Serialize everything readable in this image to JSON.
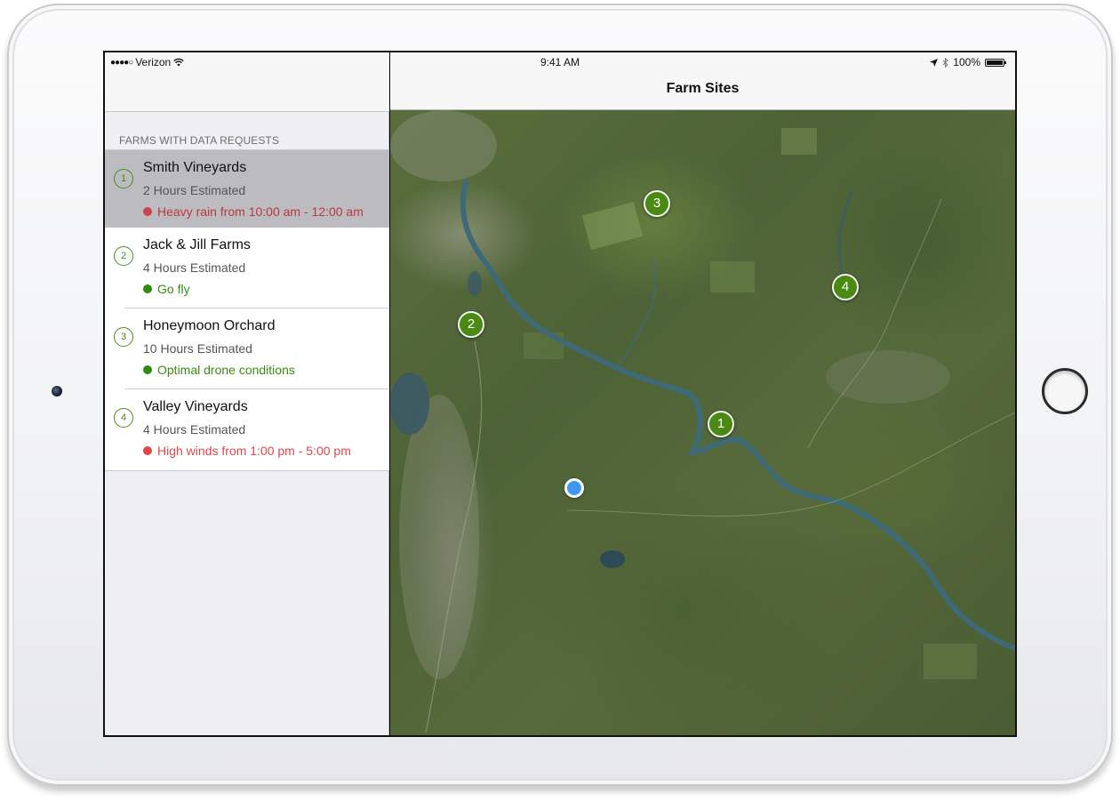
{
  "status_bar": {
    "carrier": "Verizon",
    "signal_dots": "●●●●○",
    "time": "9:41 AM",
    "battery": "100%"
  },
  "master": {
    "section_header": "FARMS WITH DATA REQUESTS",
    "farms": [
      {
        "number": "1",
        "name": "Smith Vineyards",
        "estimate": "2 Hours Estimated",
        "status": "Heavy rain from 10:00 am - 12:00 am",
        "status_type": "bad",
        "selected": true
      },
      {
        "number": "2",
        "name": "Jack & Jill Farms",
        "estimate": "4 Hours Estimated",
        "status": "Go fly",
        "status_type": "good",
        "selected": false
      },
      {
        "number": "3",
        "name": "Honeymoon Orchard",
        "estimate": "10 Hours Estimated",
        "status": "Optimal drone conditions",
        "status_type": "good",
        "selected": false
      },
      {
        "number": "4",
        "name": "Valley Vineyards",
        "estimate": "4 Hours Estimated",
        "status": "High winds from 1:00 pm - 5:00 pm",
        "status_type": "bad",
        "selected": false
      }
    ]
  },
  "detail": {
    "title": "Farm Sites",
    "map_pins": [
      "1",
      "2",
      "3",
      "4"
    ]
  },
  "colors": {
    "accent_green": "#4a8a12",
    "status_good": "#3a8d10",
    "status_bad": "#e0474c",
    "user_location": "#3d99f5",
    "river": "#3e6a78"
  },
  "icons": {
    "wifi": "wifi-icon",
    "location": "location-arrow-icon",
    "bluetooth": "bluetooth-icon",
    "battery": "battery-icon"
  }
}
